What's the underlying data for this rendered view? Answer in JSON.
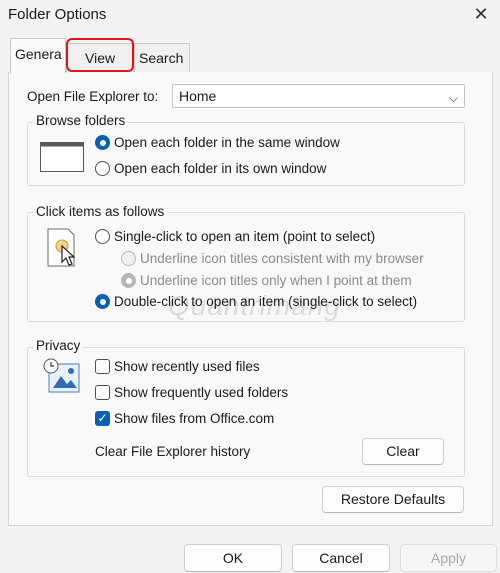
{
  "window": {
    "title": "Folder Options"
  },
  "tabs": [
    {
      "label": "Genera"
    },
    {
      "label": "View"
    },
    {
      "label": "Search"
    }
  ],
  "open_explorer": {
    "label": "Open File Explorer to:",
    "value": "Home"
  },
  "browse_folders": {
    "legend": "Browse folders",
    "options": [
      {
        "label": "Open each folder in the same window",
        "selected": true
      },
      {
        "label": "Open each folder in its own window",
        "selected": false
      }
    ]
  },
  "click_items": {
    "legend": "Click items as follows",
    "single_click": {
      "label": "Single-click to open an item (point to select)",
      "selected": false
    },
    "sub_options": [
      {
        "label": "Underline icon titles consistent with my browser",
        "selected": false,
        "enabled": false
      },
      {
        "label": "Underline icon titles only when I point at them",
        "selected": true,
        "enabled": false
      }
    ],
    "double_click": {
      "label": "Double-click to open an item (single-click to select)",
      "selected": true
    }
  },
  "privacy": {
    "legend": "Privacy",
    "checkboxes": [
      {
        "label": "Show recently used files",
        "checked": false
      },
      {
        "label": "Show frequently used folders",
        "checked": false
      },
      {
        "label": "Show files from Office.com",
        "checked": true
      }
    ],
    "clear_label": "Clear File Explorer history",
    "clear_button": "Clear"
  },
  "restore_button": "Restore Defaults",
  "footer": {
    "ok": "OK",
    "cancel": "Cancel",
    "apply": "Apply"
  },
  "watermark": "Quantrimang",
  "colors": {
    "accent": "#0a5fb4",
    "highlight": "#e0141b"
  }
}
